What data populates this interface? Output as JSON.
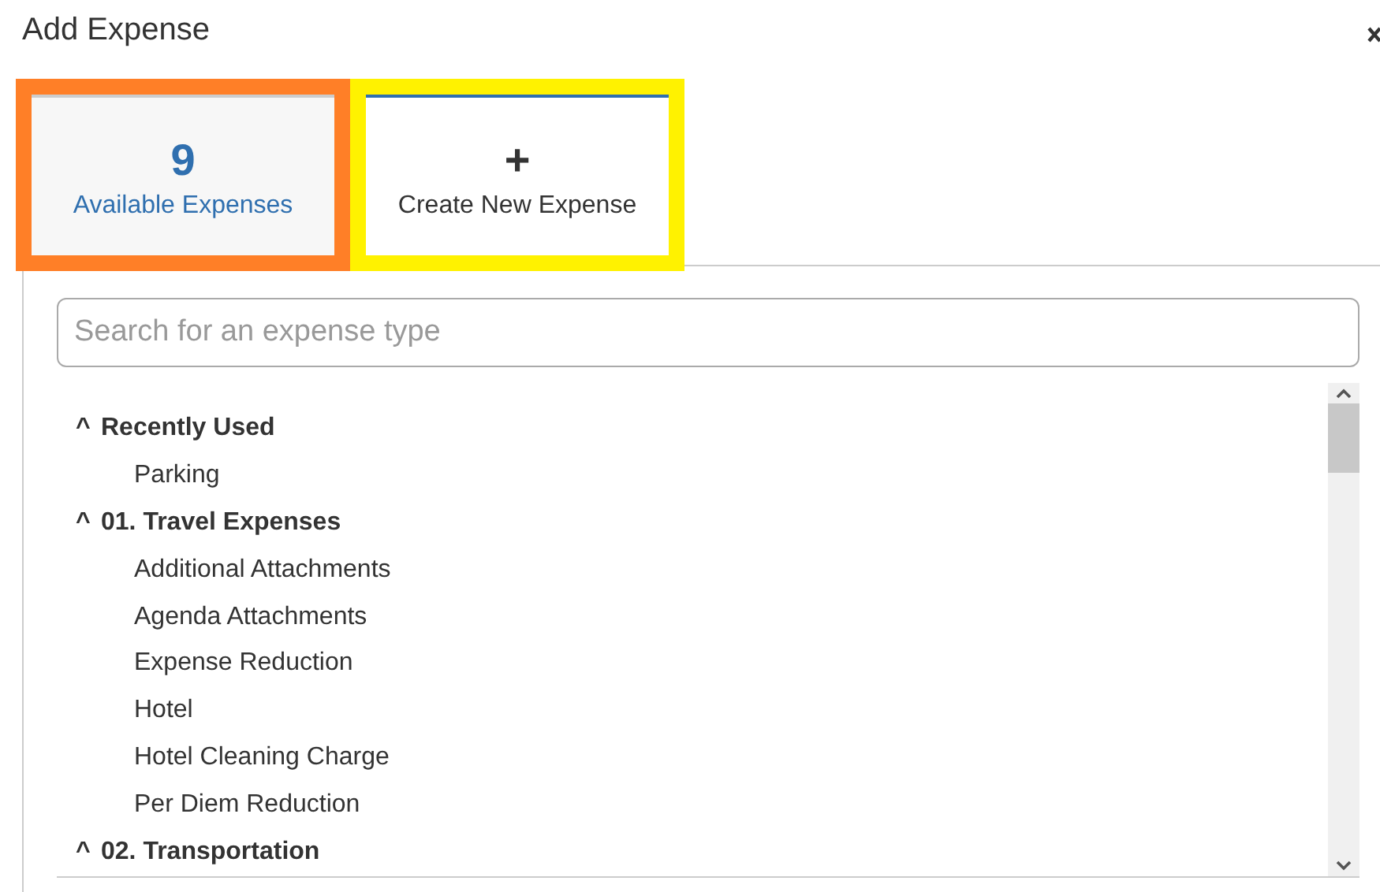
{
  "window": {
    "title": "Add Expense"
  },
  "tabs": [
    {
      "count": "9",
      "label": "Available Expenses",
      "selected": false,
      "color": "#ff7f27"
    },
    {
      "icon_text": "+",
      "label": "Create New Expense",
      "selected": true,
      "color": "#fff200"
    }
  ],
  "search": {
    "placeholder": "Search for an expense type"
  },
  "groups": [
    {
      "caret": "^",
      "label": "Recently Used",
      "expanded": true,
      "items": [
        "Parking"
      ]
    },
    {
      "caret": "^",
      "label": "01. Travel Expenses",
      "expanded": true,
      "items": [
        "Additional Attachments",
        "Agenda Attachments",
        "Expense Reduction",
        "Hotel",
        "Hotel Cleaning Charge",
        "Per Diem Reduction"
      ]
    },
    {
      "caret": "^",
      "label": "02. Transportation",
      "expanded": true
    }
  ]
}
